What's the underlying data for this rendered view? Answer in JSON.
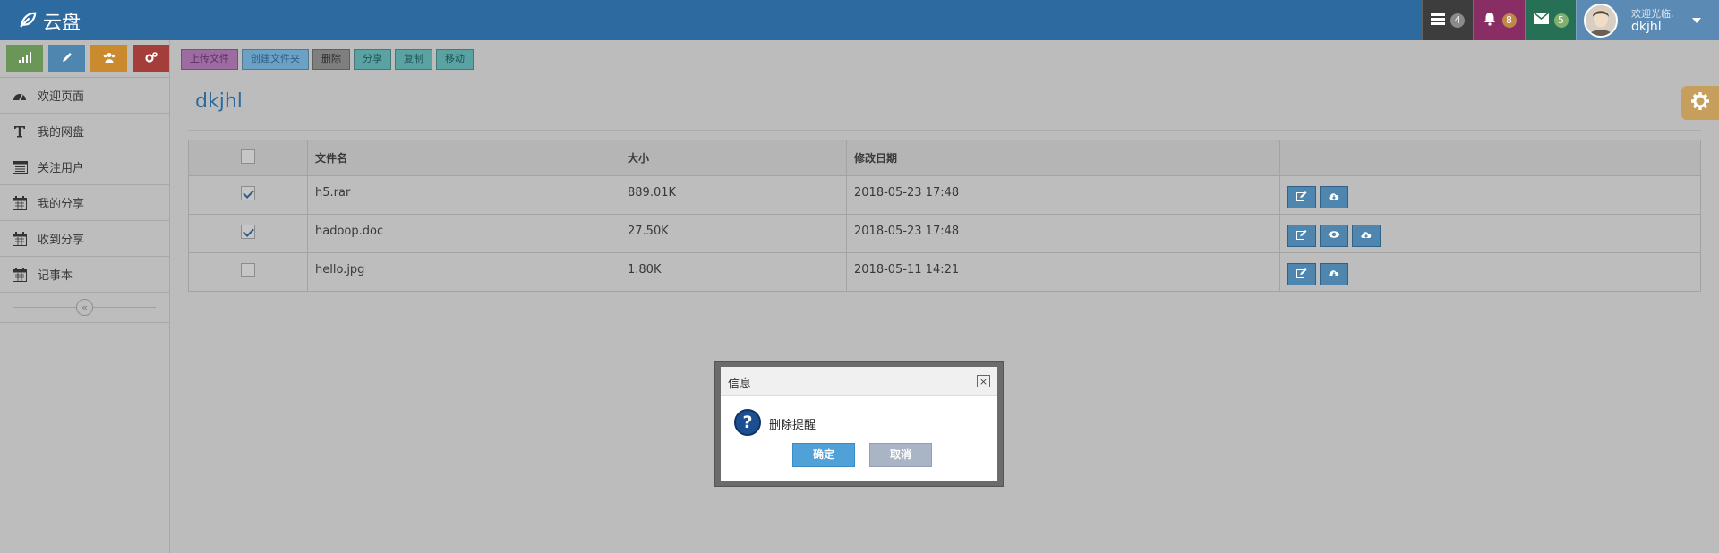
{
  "navbar": {
    "brand": "云盘",
    "tasks_badge": "4",
    "notifications_badge": "8",
    "messages_badge": "5",
    "user_greeting": "欢迎光临,",
    "user_name": "dkjhl"
  },
  "sidebar": {
    "shortcuts": [
      {
        "icon": "signal-icon",
        "color": "#6a9757"
      },
      {
        "icon": "pencil-icon",
        "color": "#4e86b0"
      },
      {
        "icon": "group-icon",
        "color": "#cc8a2e"
      },
      {
        "icon": "cogs-icon",
        "color": "#a33e3a"
      }
    ],
    "items": [
      {
        "label": "欢迎页面",
        "icon": "dashboard-icon"
      },
      {
        "label": "我的网盘",
        "icon": "text-icon"
      },
      {
        "label": "关注用户",
        "icon": "list-icon"
      },
      {
        "label": "我的分享",
        "icon": "calendar-icon"
      },
      {
        "label": "收到分享",
        "icon": "calendar-icon"
      },
      {
        "label": "记事本",
        "icon": "calendar-icon"
      }
    ],
    "collapse_glyph": "«"
  },
  "toolbar": {
    "upload": "上传文件",
    "new_folder": "创建文件夹",
    "delete": "删除",
    "share": "分享",
    "copy": "复制",
    "move": "移动"
  },
  "page": {
    "title": "dkjhl"
  },
  "table": {
    "headers": {
      "name": "文件名",
      "size": "大小",
      "date": "修改日期"
    },
    "rows": [
      {
        "checked": true,
        "name": "h5.rar",
        "size": "889.01K",
        "date": "2018-05-23 17:48"
      },
      {
        "checked": true,
        "name": "hadoop.doc",
        "size": "27.50K",
        "date": "2018-05-23 17:48"
      },
      {
        "checked": false,
        "name": "hello.jpg",
        "size": "1.80K",
        "date": "2018-05-11 14:21"
      }
    ]
  },
  "dialog": {
    "title": "信息",
    "message": "删除提醒",
    "ok": "确定",
    "cancel": "取消"
  },
  "colors": {
    "navbar": "#2c6aa0",
    "accent": "#4e86b0"
  }
}
